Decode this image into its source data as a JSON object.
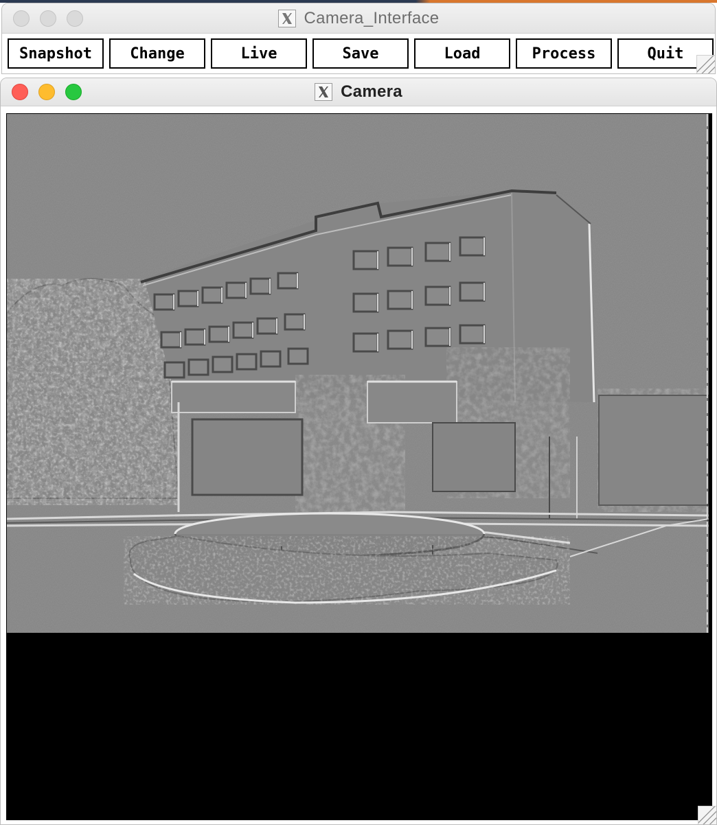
{
  "windows": {
    "interface": {
      "title": "Camera_Interface",
      "app_icon": "x11-icon",
      "buttons": [
        {
          "label": "Snapshot"
        },
        {
          "label": "Change"
        },
        {
          "label": "Live"
        },
        {
          "label": "Save"
        },
        {
          "label": "Load"
        },
        {
          "label": "Process"
        },
        {
          "label": "Quit"
        }
      ]
    },
    "camera": {
      "title": "Camera",
      "app_icon": "x11-icon",
      "image_description_icon": "embossed-image"
    }
  },
  "colors": {
    "close": "#ff5f57",
    "minimize": "#febc2e",
    "maximize": "#28c840",
    "emboss_gray": "#808080",
    "canvas_bg": "#000000"
  }
}
